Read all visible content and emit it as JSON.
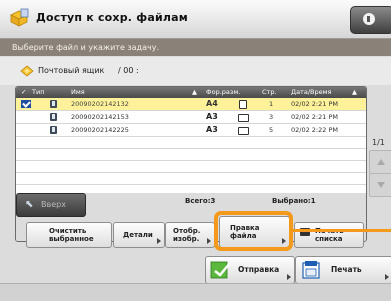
{
  "header": {
    "title": "Доступ к сохр. файлам"
  },
  "instruction": "Выберите файл и укажите задачу.",
  "mailbox": {
    "label": "Почтовый ящик",
    "number": "/ 00 :"
  },
  "table": {
    "columns": {
      "type": "Тип",
      "name": "Имя",
      "size": "Фор.разм.",
      "pages": "Стр.",
      "date": "Дата/Время"
    },
    "rows": [
      {
        "name": "20090202142132",
        "size": "A4",
        "pages": "1",
        "date": "02/02 2:21 PM",
        "selected": true
      },
      {
        "name": "20090202142153",
        "size": "A3",
        "pages": "3",
        "date": "02/02 2:21 PM",
        "selected": false
      },
      {
        "name": "20090202142225",
        "size": "A3",
        "pages": "5",
        "date": "02/02 2:22 PM",
        "selected": false
      }
    ],
    "total": "Всего:3",
    "selected": "Выбрано:1"
  },
  "navigation": {
    "up_label": "Вверх",
    "page_indicator": "1/1"
  },
  "buttons": {
    "clear": "Очистить выбранное",
    "details": "Детали",
    "display_image": "Отобр. изобр.",
    "edit_file": "Правка файла",
    "print_list": "Печать списка",
    "send": "Отправка",
    "print": "Печать"
  },
  "colors": {
    "accent": "#f39a1c",
    "selected_row": "#fdf29a",
    "instruction_bar": "#8a8278",
    "table_header": "#555555"
  },
  "icons": {
    "title": "mailbox-folder-icon",
    "mailbox": "diamond-mailbox-icon",
    "send": "send-arrow-icon",
    "print": "print-icon"
  }
}
